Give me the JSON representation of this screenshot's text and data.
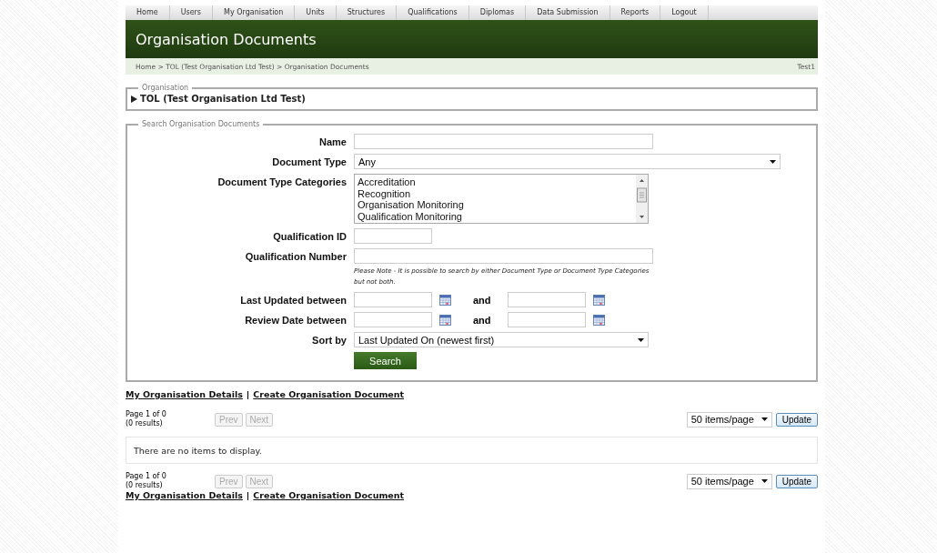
{
  "nav": [
    {
      "label": "Home"
    },
    {
      "label": "Users"
    },
    {
      "label": "My Organisation"
    },
    {
      "label": "Units"
    },
    {
      "label": "Structures"
    },
    {
      "label": "Qualifications"
    },
    {
      "label": "Diplomas"
    },
    {
      "label": "Data Submission"
    },
    {
      "label": "Reports"
    },
    {
      "label": "Logout"
    }
  ],
  "header": {
    "title": "Organisation Documents"
  },
  "breadcrumb": {
    "path": "Home > TOL (Test Organisation Ltd Test) > Organisation Documents",
    "user": "Test1"
  },
  "organisation": {
    "legend": "Organisation",
    "name": "TOL (Test Organisation Ltd Test)",
    "expanded": false
  },
  "search": {
    "legend": "Search Organisation Documents",
    "rows": [
      {
        "kind": "text",
        "label": "Name"
      },
      {
        "kind": "select",
        "label": "Document Type",
        "value": "Any"
      },
      {
        "kind": "listbox",
        "label": "Document Type Categories",
        "options": [
          {
            "label": "Accreditation",
            "selected": false
          },
          {
            "label": "Recognition",
            "selected": false
          },
          {
            "label": "Organisation Monitoring",
            "selected": false
          },
          {
            "label": "Qualification Monitoring",
            "selected": false
          }
        ]
      },
      {
        "kind": "text",
        "label": "Qualification ID"
      },
      {
        "kind": "text",
        "label": "Qualification Number"
      },
      {
        "kind": "note",
        "text": "Please Note - It is possible to search by either Document Type or Document Type Categories but not both."
      },
      {
        "kind": "daterange",
        "label": "Last Updated between",
        "joiner": "and"
      },
      {
        "kind": "daterange",
        "label": "Review Date between",
        "joiner": "and"
      },
      {
        "kind": "select",
        "label": "Sort by",
        "value": "Last Updated On (newest first)"
      },
      {
        "kind": "button",
        "label": "Search"
      }
    ]
  },
  "sections": [
    {
      "kind": "links",
      "links": [
        "My Organisation Details",
        "Create Organisation Document"
      ],
      "separator": "|"
    },
    {
      "kind": "pager",
      "page": "Page 1 of 0",
      "results": "(0 results)",
      "prev": {
        "label": "Prev",
        "disabled": true
      },
      "next": {
        "label": "Next",
        "disabled": true
      },
      "per_page": "50 items/page",
      "update": "Update"
    },
    {
      "kind": "empty",
      "text": "There are no items to display."
    },
    {
      "kind": "pager",
      "page": "Page 1 of 0",
      "results": "(0 results)",
      "prev": {
        "label": "Prev",
        "disabled": true
      },
      "next": {
        "label": "Next",
        "disabled": true
      },
      "per_page": "50 items/page",
      "update": "Update"
    },
    {
      "kind": "links",
      "links": [
        "My Organisation Details",
        "Create Organisation Document"
      ],
      "separator": "|"
    }
  ]
}
